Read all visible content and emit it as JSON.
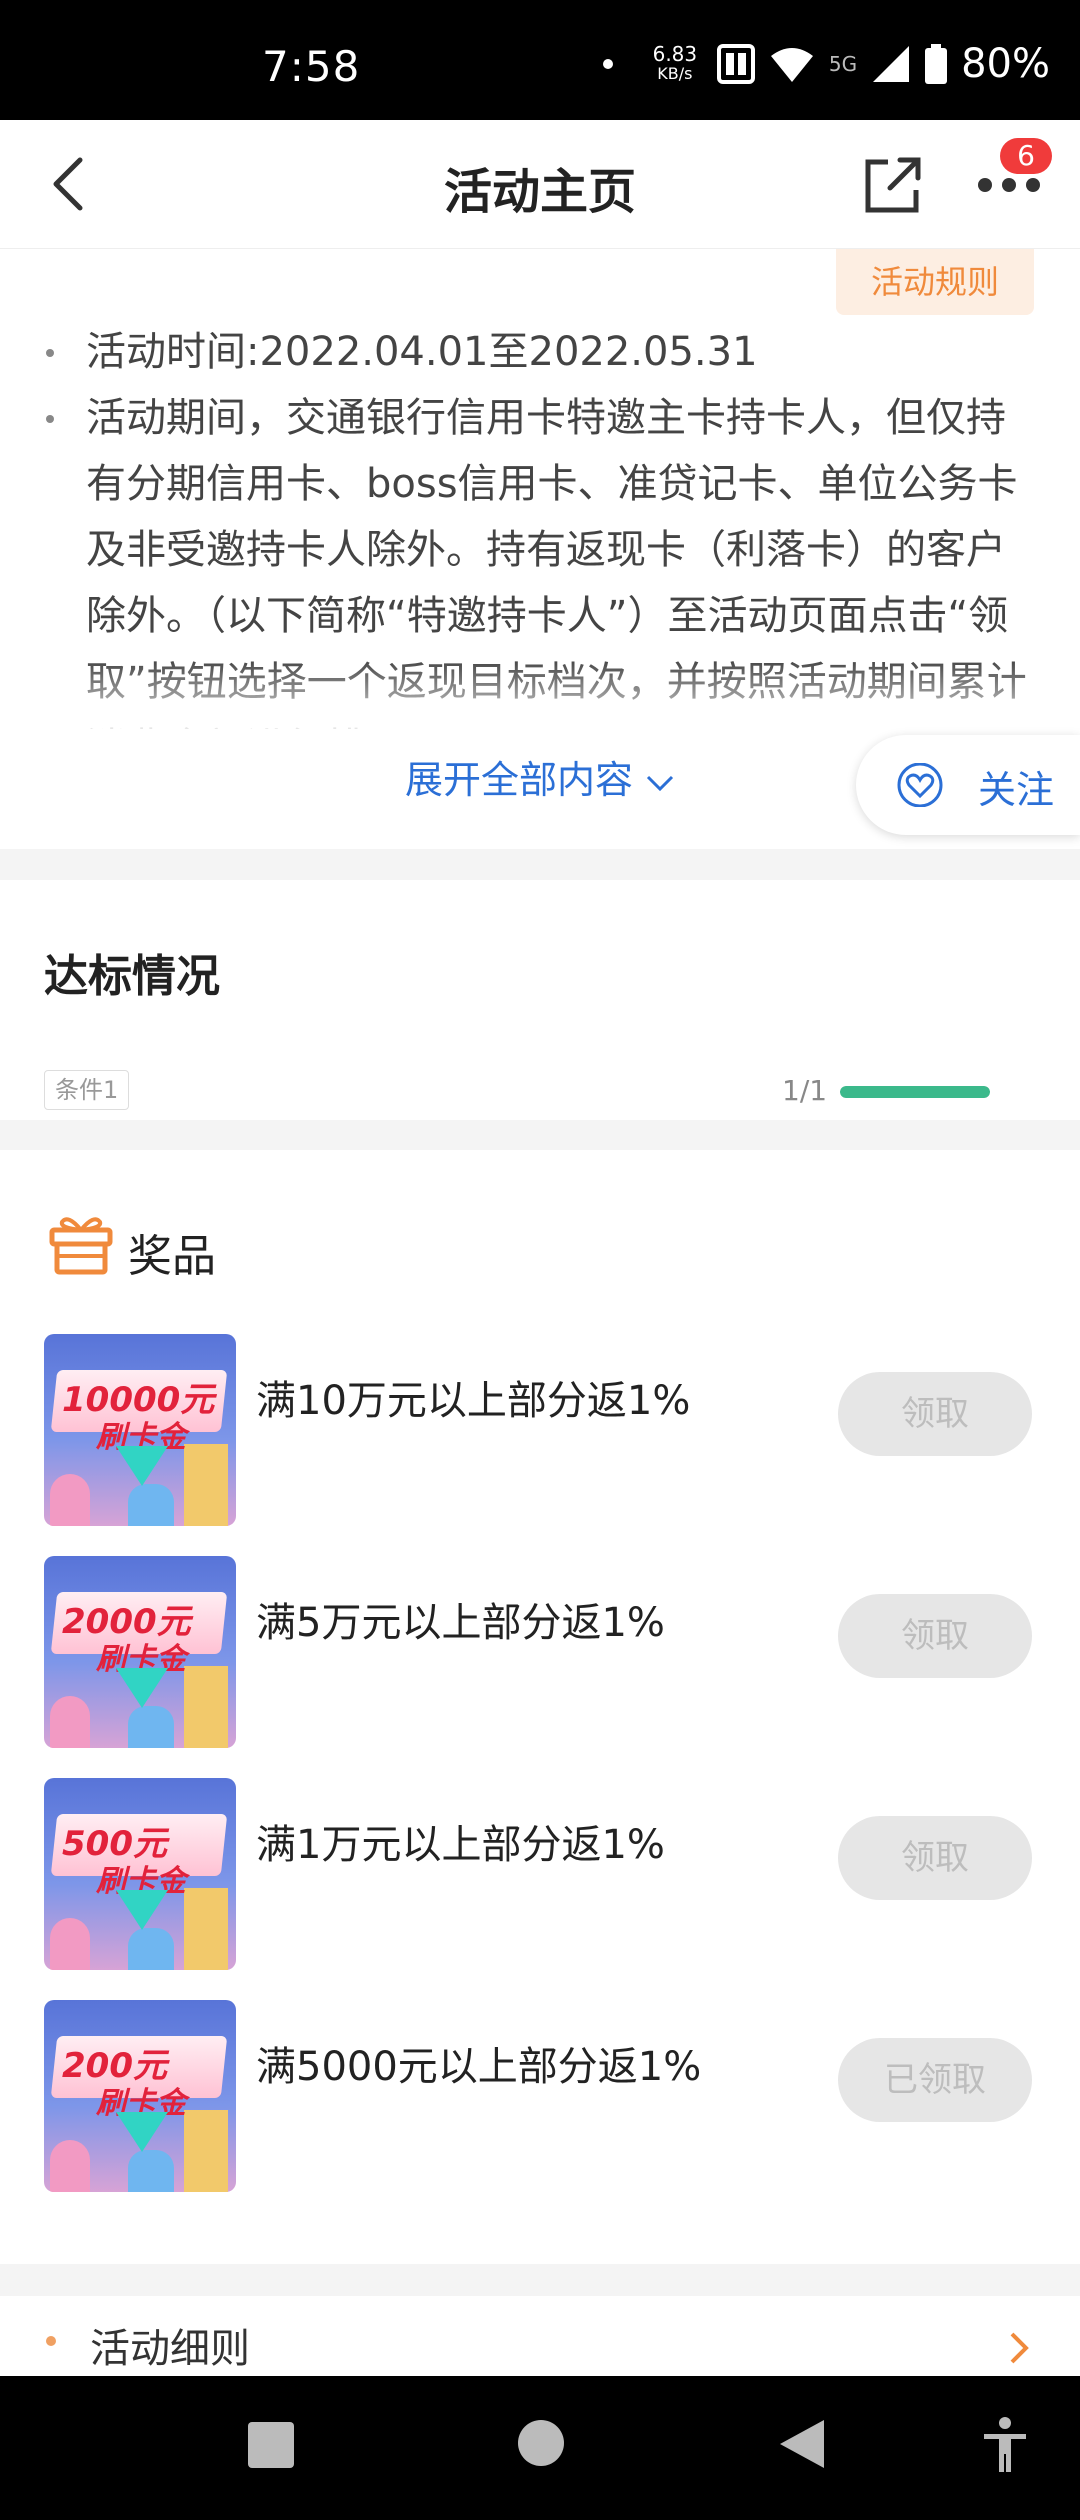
{
  "status_bar": {
    "time": "7:58",
    "net_speed_value": "6.83",
    "net_speed_unit": "KB/s",
    "network_type": "5G",
    "battery": "80%"
  },
  "header": {
    "title": "活动主页",
    "badge_count": "6"
  },
  "rules": {
    "tag_label": "活动规则",
    "items": [
      "活动时间:2022.04.01至2022.05.31",
      "活动期间，交通银行信用卡特邀主卡持卡人，但仅持有分期信用卡、boss信用卡、准贷记卡、单位公务卡及非受邀持卡人除外。持有返现卡（利落卡）的客户除外。（以下简称“特邀持卡人”）至活动页面点击“领取”按钮选择一个返现目标档次，并按照活动期间累计消费金额进行排"
    ],
    "expand_label": "展开全部内容",
    "follow_label": "关注"
  },
  "progress": {
    "title": "达标情况",
    "condition_label": "条件1",
    "fraction_label": "1/1",
    "fraction_value": 1
  },
  "prizes": {
    "title": "奖品",
    "items": [
      {
        "image_amount": "10000元",
        "image_sub": "刷卡金",
        "name": "满10万元以上部分返1%",
        "button": "领取"
      },
      {
        "image_amount": "2000元",
        "image_sub": "刷卡金",
        "name": "满5万元以上部分返1%",
        "button": "领取"
      },
      {
        "image_amount": "500元",
        "image_sub": "刷卡金",
        "name": "满1万元以上部分返1%",
        "button": "领取"
      },
      {
        "image_amount": "200元",
        "image_sub": "刷卡金",
        "name": "满5000元以上部分返1%",
        "button": "已领取"
      }
    ]
  },
  "detail": {
    "label": "活动细则"
  },
  "colors": {
    "accent_blue": "#2b6fd6",
    "accent_orange": "#f08a3c",
    "progress_green": "#3bb98b",
    "badge_red": "#f03b3b"
  }
}
